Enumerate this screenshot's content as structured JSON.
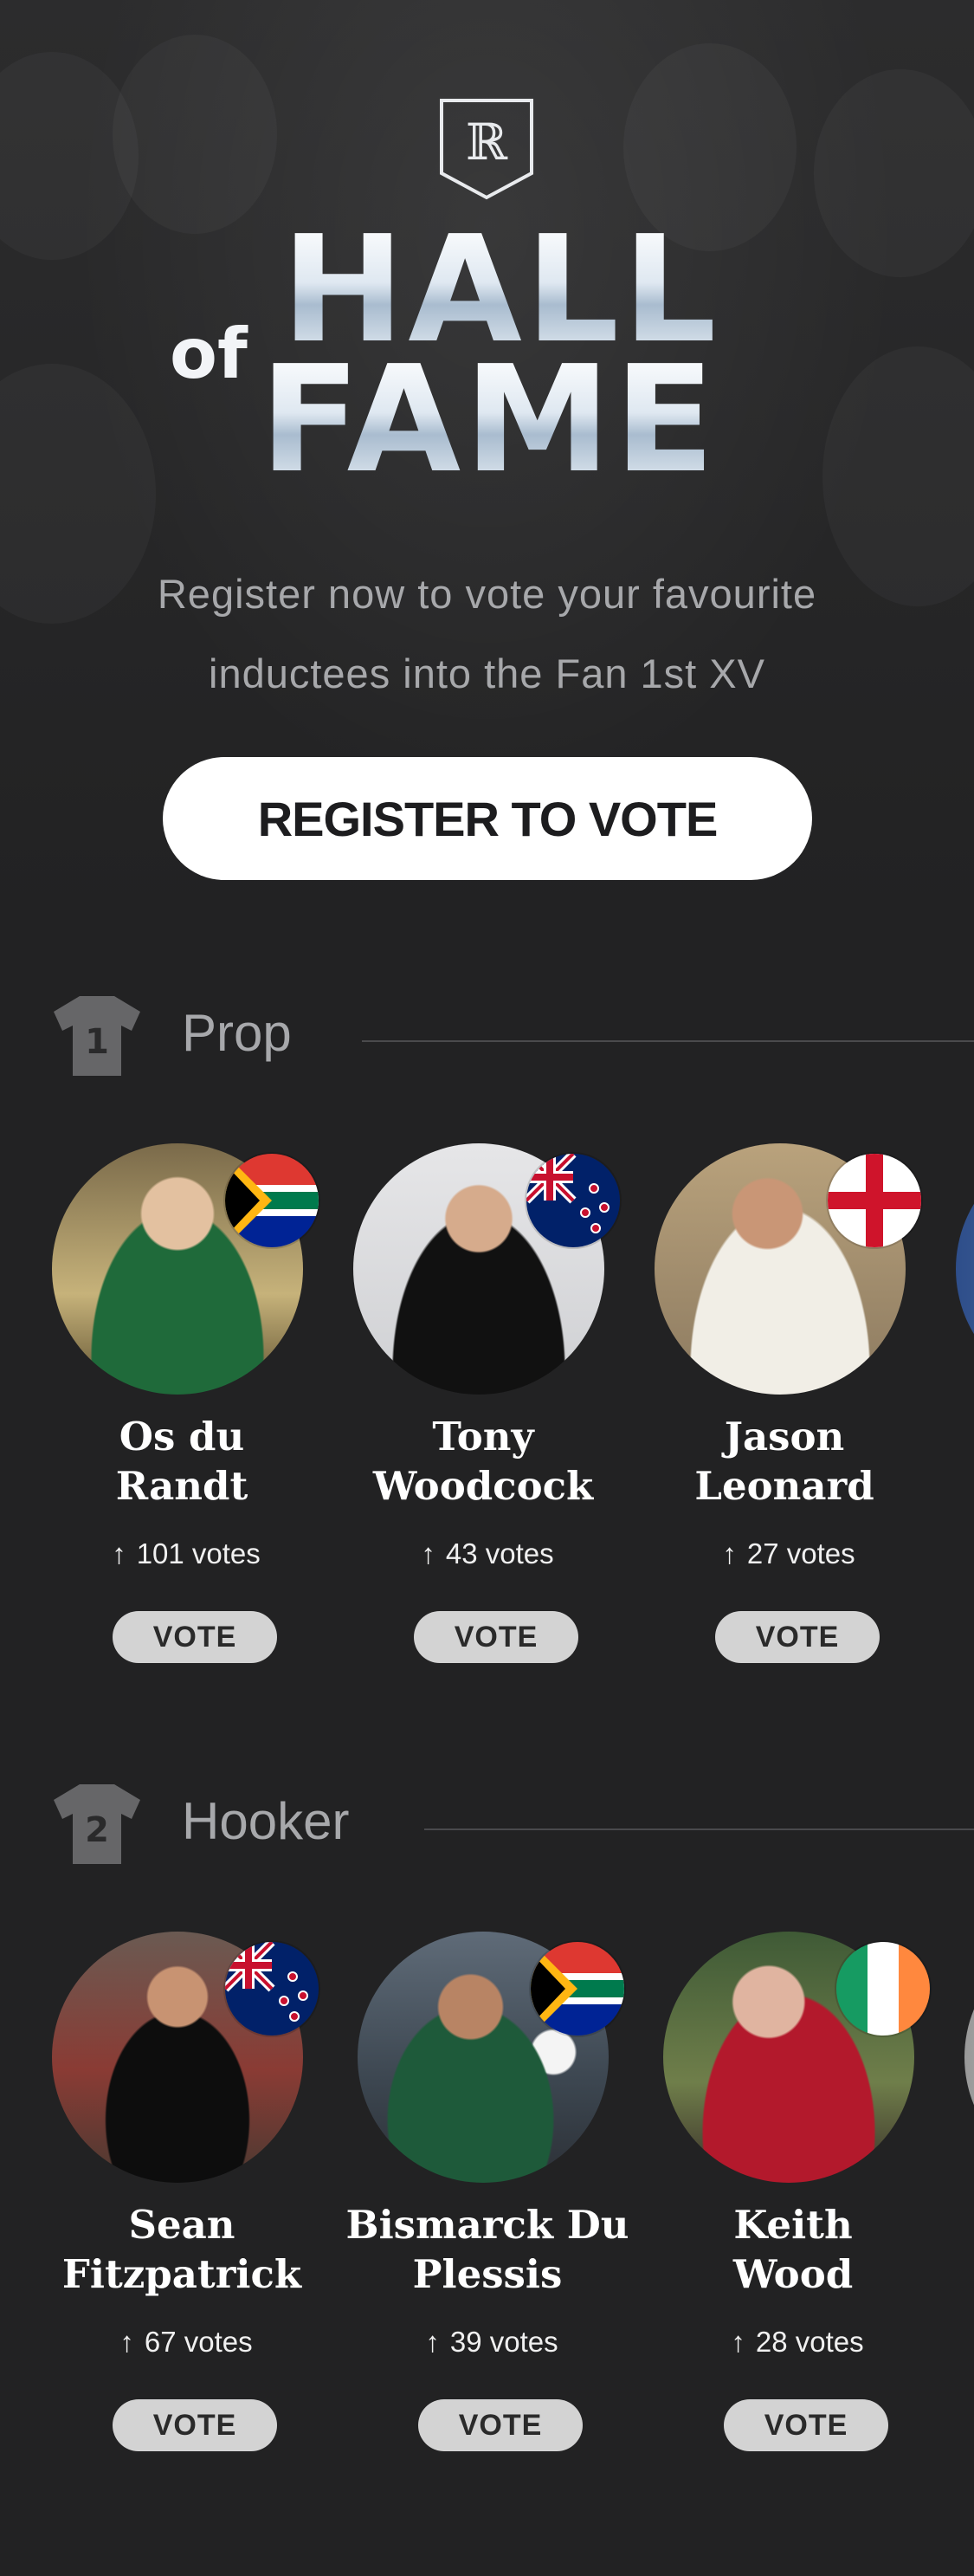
{
  "hero": {
    "title_of": "of",
    "title_hall": "HALL",
    "title_fame": "FAME",
    "subtitle_line1": "Register now to vote your favourite",
    "subtitle_line2": "inductees into the Fan 1st XV",
    "register_label": "REGISTER TO VOTE"
  },
  "colors": {
    "background": "#222223",
    "muted_text": "#a7a8ab",
    "vote_button": "#d3d3d3"
  },
  "sections": [
    {
      "number": "1",
      "title": "Prop",
      "players": [
        {
          "name_line1": "Os du",
          "name_line2": "Randt",
          "votes": "101 votes",
          "flag": "south-africa",
          "vote_label": "VOTE"
        },
        {
          "name_line1": "Tony",
          "name_line2": "Woodcock",
          "votes": "43 votes",
          "flag": "new-zealand",
          "vote_label": "VOTE"
        },
        {
          "name_line1": "Jason",
          "name_line2": "Leonard",
          "votes": "27 votes",
          "flag": "england",
          "vote_label": "VOTE"
        }
      ]
    },
    {
      "number": "2",
      "title": "Hooker",
      "players": [
        {
          "name_line1": "Sean",
          "name_line2": "Fitzpatrick",
          "votes": "67 votes",
          "flag": "new-zealand",
          "vote_label": "VOTE"
        },
        {
          "name_line1": "Bismarck Du",
          "name_line2": "Plessis",
          "votes": "39 votes",
          "flag": "south-africa",
          "vote_label": "VOTE"
        },
        {
          "name_line1": "Keith",
          "name_line2": "Wood",
          "votes": "28 votes",
          "flag": "ireland",
          "vote_label": "VOTE"
        }
      ]
    }
  ]
}
